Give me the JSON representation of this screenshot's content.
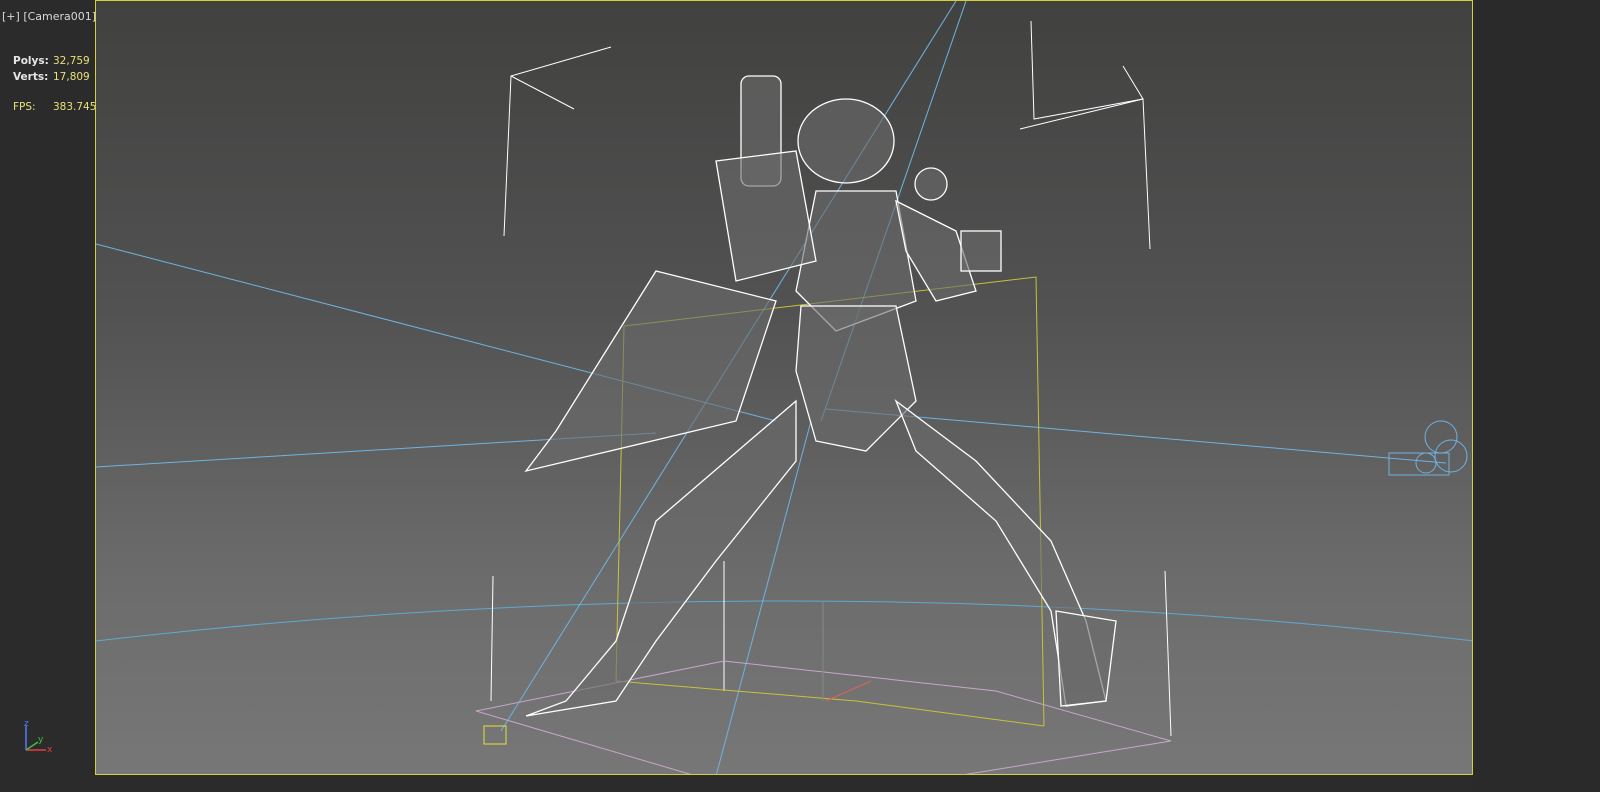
{
  "viewport": {
    "menu_label": "[+]",
    "camera_label": "[Camera001]"
  },
  "stats": {
    "polys_label": "Polys:",
    "polys_value": "32,759",
    "verts_label": "Verts:",
    "verts_value": "17,809",
    "fps_label": "FPS:",
    "fps_value": "383.745"
  },
  "gizmo": {
    "z_label": "z",
    "y_label": "y",
    "x_label": "x"
  },
  "colors": {
    "frame": "#d6cf3a",
    "wire": "#ffffff",
    "light_line": "#6fb3e0",
    "bbox": "#c8c23a",
    "ground": "#c9a6c9"
  }
}
